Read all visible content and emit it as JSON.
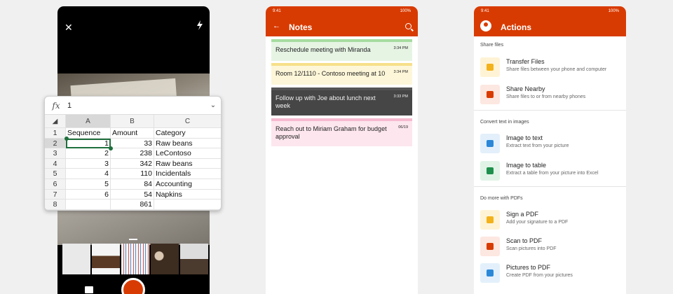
{
  "excel": {
    "fx_label": "fx",
    "formula_value": "1",
    "columns": [
      "A",
      "B",
      "C"
    ],
    "rows": [
      {
        "n": "1",
        "a": "Sequence",
        "b": "Amount",
        "c": "Category"
      },
      {
        "n": "2",
        "a": "1",
        "b": "33",
        "c": "Raw beans"
      },
      {
        "n": "3",
        "a": "2",
        "b": "238",
        "c": "LeContoso"
      },
      {
        "n": "4",
        "a": "3",
        "b": "342",
        "c": "Raw beans"
      },
      {
        "n": "5",
        "a": "4",
        "b": "110",
        "c": "Incidentals"
      },
      {
        "n": "6",
        "a": "5",
        "b": "84",
        "c": "Accounting"
      },
      {
        "n": "7",
        "a": "6",
        "b": "54",
        "c": "Napkins"
      },
      {
        "n": "8",
        "a": "",
        "b": "861",
        "c": ""
      }
    ]
  },
  "notes": {
    "status_time": "9:41",
    "status_battery": "100%",
    "title": "Notes",
    "items": [
      {
        "text": "Reschedule meeting with Miranda",
        "time": "3:34 PM",
        "bg": "#e6f4e4",
        "accent": "#a6dca0",
        "fg": "#222222"
      },
      {
        "text": "Room 12/1110 - Contoso meeting at 10",
        "time": "3:34 PM",
        "bg": "#fdf6d8",
        "accent": "#f7e08a",
        "fg": "#222222"
      },
      {
        "text": "Follow up with Joe about lunch next week",
        "time": "3:33 PM",
        "bg": "#464646",
        "accent": "#555555",
        "fg": "#f2f2f2"
      },
      {
        "text": "Reach out to Miriam Graham for budget approval",
        "time": "06/19",
        "bg": "#fde6ee",
        "accent": "#f6b9cf",
        "fg": "#222222"
      }
    ]
  },
  "actions": {
    "status_time": "9:41",
    "status_battery": "100%",
    "title": "Actions",
    "sections": [
      {
        "header": "Share files",
        "items": [
          {
            "title": "Transfer Files",
            "sub": "Share files between your phone and computer",
            "icon": "transfer-files-icon",
            "tint": "#fff3d6",
            "color": "#f3b21b"
          },
          {
            "title": "Share Nearby",
            "sub": "Share files to or from nearby phones",
            "icon": "share-nearby-icon",
            "tint": "#fde7e1",
            "color": "#d83b01"
          }
        ]
      },
      {
        "header": "Convert text in images",
        "items": [
          {
            "title": "Image to text",
            "sub": "Extract text from your picture",
            "icon": "image-to-text-icon",
            "tint": "#e3f0fb",
            "color": "#2b88d8"
          },
          {
            "title": "Image to table",
            "sub": "Extract a table from your picture into Excel",
            "icon": "image-to-table-icon",
            "tint": "#e1f3e6",
            "color": "#1e8f4c"
          }
        ]
      },
      {
        "header": "Do more with PDFs",
        "items": [
          {
            "title": "Sign a PDF",
            "sub": "Add your signature to a PDF",
            "icon": "sign-pdf-icon",
            "tint": "#fff3d6",
            "color": "#f3b21b"
          },
          {
            "title": "Scan to PDF",
            "sub": "Scan pictures into PDF",
            "icon": "scan-to-pdf-icon",
            "tint": "#fde7e1",
            "color": "#d83b01"
          },
          {
            "title": "Pictures to PDF",
            "sub": "Create PDF from your pictures",
            "icon": "pictures-to-pdf-icon",
            "tint": "#e3f0fb",
            "color": "#2b88d8"
          }
        ]
      }
    ]
  }
}
